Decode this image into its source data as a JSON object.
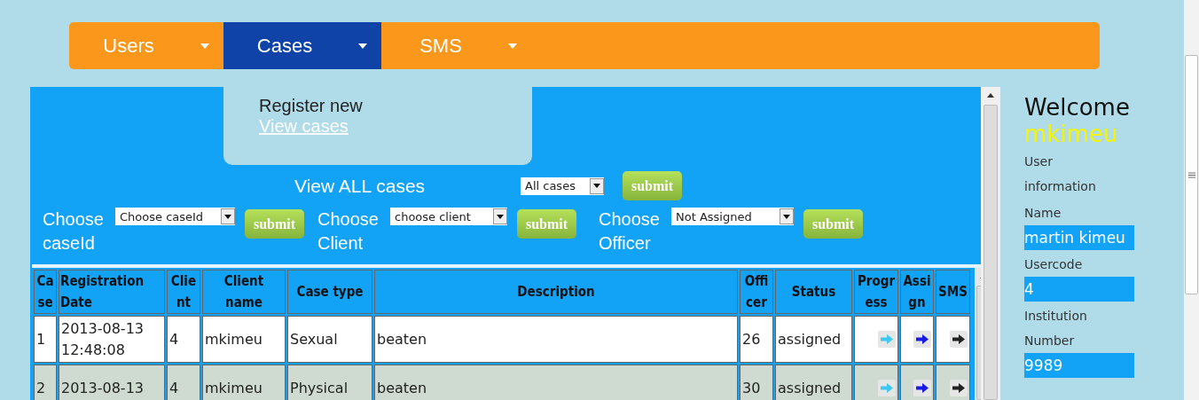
{
  "nav": [
    {
      "label": "Users",
      "selected": false
    },
    {
      "label": "Cases",
      "selected": true
    },
    {
      "label": "SMS",
      "selected": false
    }
  ],
  "menu": [
    {
      "label": "Register new",
      "kind": "text"
    },
    {
      "label": "View cases",
      "kind": "link"
    }
  ],
  "view_all": {
    "title": "View ALL cases",
    "select": "All cases",
    "button": "submit"
  },
  "filters": [
    {
      "label": "Choose caseId",
      "select": "Choose caseId",
      "button": "submit"
    },
    {
      "label": "Choose Client",
      "select": "choose client",
      "button": "submit"
    },
    {
      "label": "Choose Officer",
      "select": "Not Assigned",
      "button": "submit"
    }
  ],
  "table": {
    "columns": [
      "Case",
      "Registration Date",
      "Client",
      "Client name",
      "Case type",
      "Description",
      "Officer",
      "Status",
      "Progress",
      "Assign",
      "SMS"
    ],
    "rows": [
      {
        "cells": [
          "1",
          "2013-08-13 12:48:08",
          "4",
          "mkimeu",
          "Sexual",
          "beaten",
          "26",
          "assigned"
        ]
      },
      {
        "cells": [
          "2",
          "2013-08-13",
          "4",
          "mkimeu",
          "Physical",
          "beaten",
          "30",
          "assigned"
        ]
      }
    ]
  },
  "sidebar": {
    "welcome": "Welcome",
    "username": "mkimeu",
    "section": "User information",
    "fields": [
      {
        "label": "Name",
        "value": "martin kimeu"
      },
      {
        "label": "Usercode",
        "value": "4"
      },
      {
        "label": "Institution Number",
        "value": "9989"
      }
    ]
  }
}
